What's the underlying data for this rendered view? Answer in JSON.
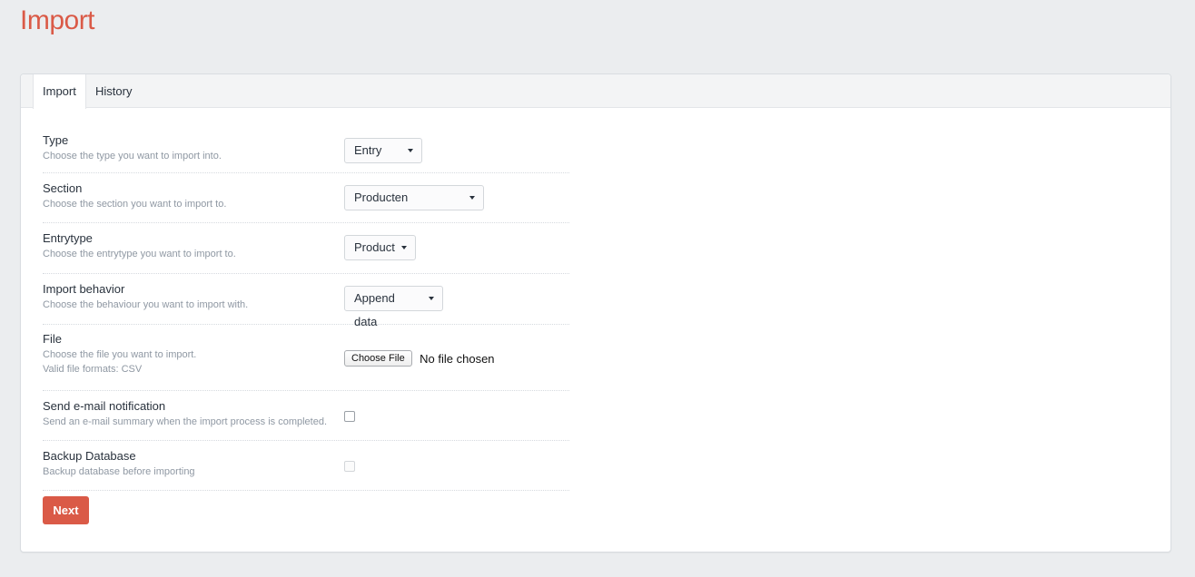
{
  "page": {
    "title": "Import"
  },
  "tabs": [
    {
      "label": "Import",
      "selected": true
    },
    {
      "label": "History",
      "selected": false
    }
  ],
  "fields": {
    "type": {
      "label": "Type",
      "instructions": "Choose the type you want to import into.",
      "value": "Entry"
    },
    "section": {
      "label": "Section",
      "instructions": "Choose the section you want to import to.",
      "value": "Producten"
    },
    "entrytype": {
      "label": "Entrytype",
      "instructions": "Choose the entrytype you want to import to.",
      "value": "Product"
    },
    "behavior": {
      "label": "Import behavior",
      "instructions": "Choose the behaviour you want to import with.",
      "value": "Append data"
    },
    "file": {
      "label": "File",
      "instructions": "Choose the file you want to import.",
      "formats": "Valid file formats: CSV",
      "button": "Choose File",
      "status": "No file chosen"
    },
    "email": {
      "label": "Send e-mail notification",
      "instructions": "Send an e-mail summary when the import process is completed.",
      "checked": false
    },
    "backup": {
      "label": "Backup Database",
      "instructions": "Backup database before importing",
      "checked": false,
      "disabled": true
    }
  },
  "actions": {
    "next_label": "Next"
  },
  "colors": {
    "accent": "#da5a47",
    "background": "#ebedef"
  }
}
